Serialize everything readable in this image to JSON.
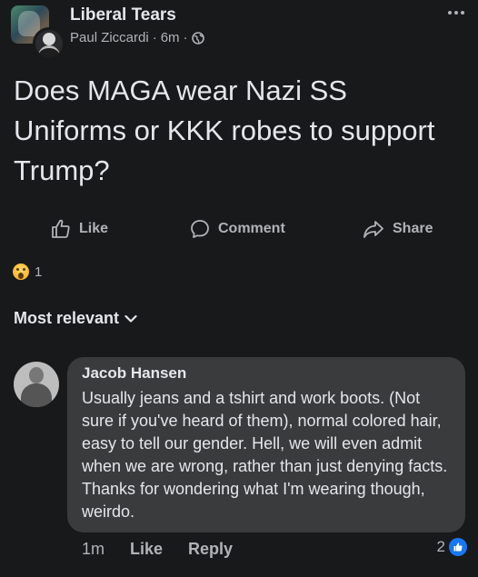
{
  "header": {
    "group_name": "Liberal Tears",
    "author": "Paul Ziccardi",
    "time": "6m",
    "separator": "·"
  },
  "post": {
    "text": "Does MAGA wear Nazi SS Uniforms or KKK robes to support Trump?"
  },
  "actions": {
    "like": "Like",
    "comment": "Comment",
    "share": "Share"
  },
  "reactions": {
    "count": "1"
  },
  "sort": {
    "label": "Most relevant"
  },
  "comment": {
    "author": "Jacob Hansen",
    "text": "Usually jeans and a tshirt and work boots. (Not sure if you've heard of them), normal colored hair, easy to tell our gender. Hell, we will even admit when we are wrong, rather than just denying facts. Thanks for wondering what I'm wearing though, weirdo.",
    "time": "1m",
    "like": "Like",
    "reply": "Reply",
    "reaction_count": "2"
  },
  "colors": {
    "background": "#18191a",
    "bubble": "#3a3b3c",
    "primary_text": "#e4e6eb",
    "secondary_text": "#b0b3b8",
    "like_blue": "#1877f2"
  }
}
